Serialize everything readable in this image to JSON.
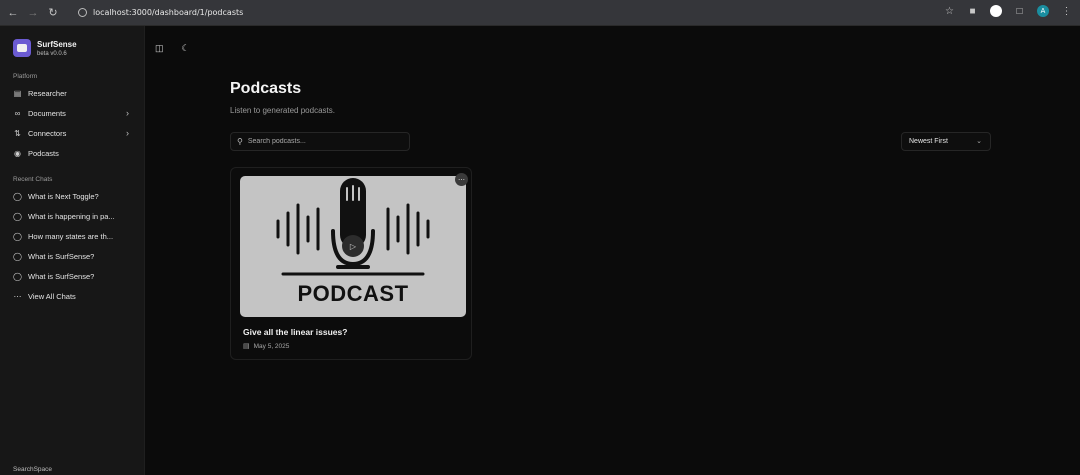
{
  "browser": {
    "url": "localhost:3000/dashboard/1/podcasts",
    "avatar_letter": "A"
  },
  "sidebar": {
    "app_name": "SurfSense",
    "app_version": "beta v0.0.6",
    "platform_label": "Platform",
    "platform_items": [
      {
        "label": "Researcher",
        "icon": "book-icon"
      },
      {
        "label": "Documents",
        "icon": "paperclip-icon"
      },
      {
        "label": "Connectors",
        "icon": "cable-icon"
      },
      {
        "label": "Podcasts",
        "icon": "podcast-icon"
      }
    ],
    "recent_label": "Recent Chats",
    "recent_chats": [
      "What is Next Toggle?",
      "What is happening in pa...",
      "How many states are th...",
      "What is SurfSense?",
      "What is SurfSense?"
    ],
    "view_all_label": "View All Chats",
    "footer_label": "SearchSpace"
  },
  "main": {
    "title": "Podcasts",
    "subtitle": "Listen to generated podcasts.",
    "search_placeholder": "Search podcasts...",
    "sort_label": "Newest First",
    "podcasts": [
      {
        "title": "Give all the linear issues?",
        "date": "May 5, 2025",
        "thumbnail_text": "PODCAST"
      }
    ]
  }
}
